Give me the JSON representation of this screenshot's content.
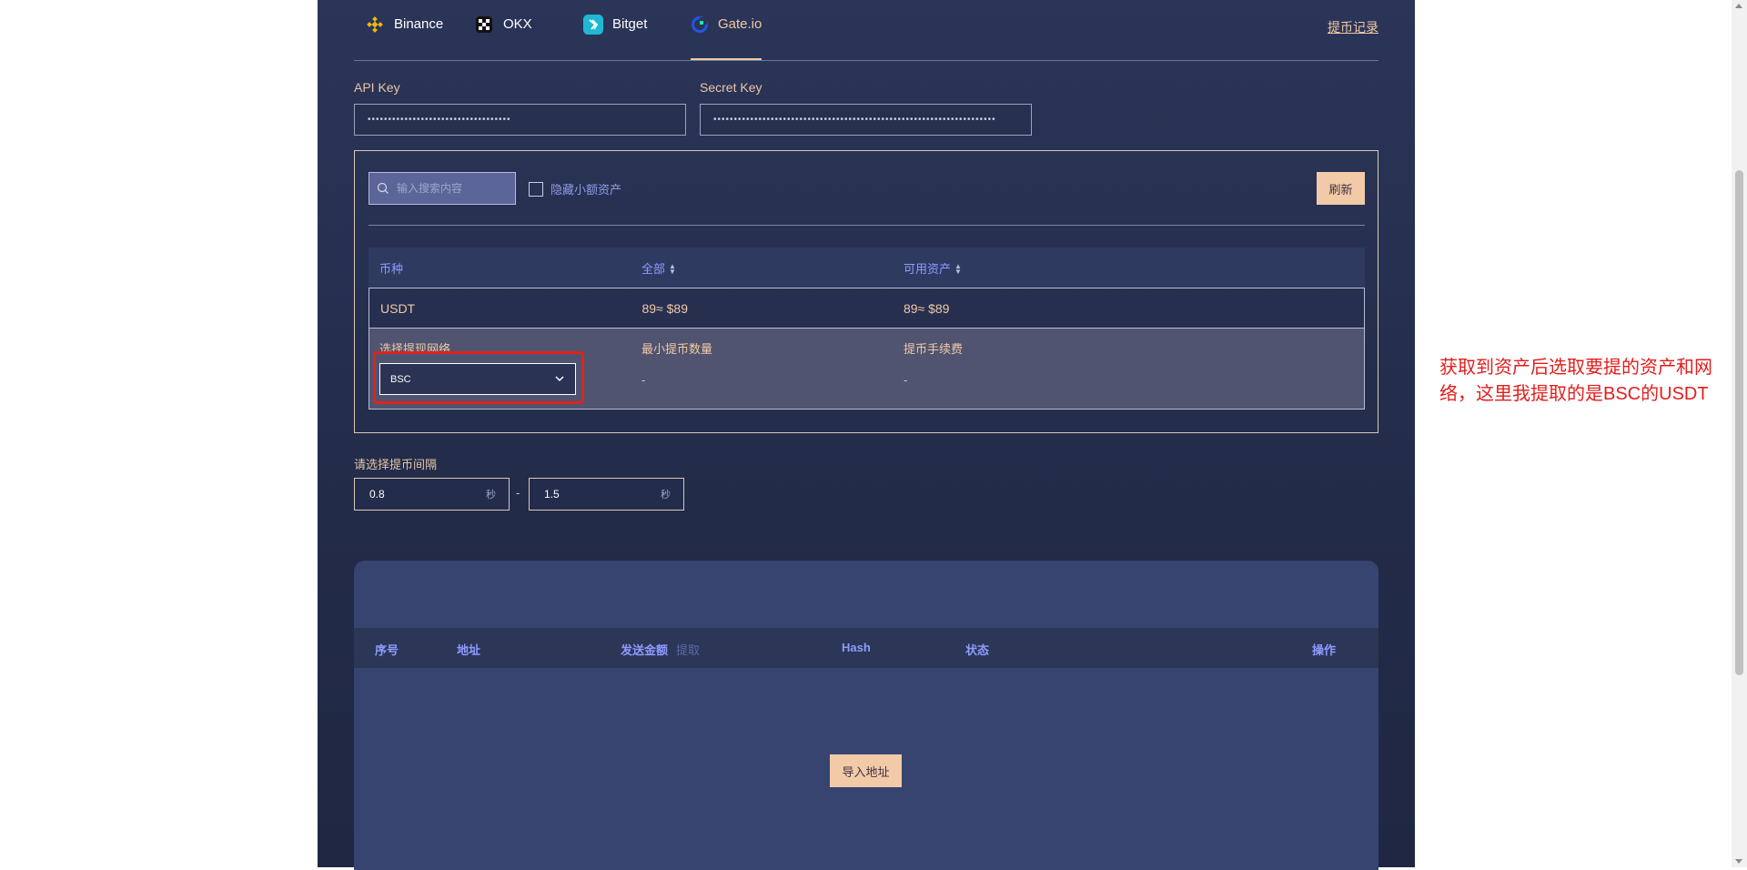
{
  "tabs": [
    {
      "label": "Binance",
      "icon": "binance-icon"
    },
    {
      "label": "OKX",
      "icon": "okx-icon"
    },
    {
      "label": "Bitget",
      "icon": "bitget-icon"
    },
    {
      "label": "Gate.io",
      "icon": "gateio-icon",
      "active": true
    }
  ],
  "record_link": "提币记录",
  "api_key": {
    "label": "API Key",
    "value": "•••••••••••••••••••••••••••••••••••"
  },
  "secret_key": {
    "label": "Secret Key",
    "value": "•••••••••••••••••••••••••••••••••••••••••••••••••••••••••••••••••••••"
  },
  "assets": {
    "search_placeholder": "输入搜索内容",
    "hide_small_label": "隐藏小额资产",
    "refresh_label": "刷新",
    "columns": [
      "币种",
      "全部",
      "可用资产"
    ],
    "row": {
      "coin": "USDT",
      "total": "89≈ $89",
      "available": "89≈ $89"
    },
    "network": {
      "select_label": "选择提现网络",
      "selected": "BSC",
      "min_label": "最小提币数量",
      "min_value": "-",
      "fee_label": "提币手续费",
      "fee_value": "-"
    }
  },
  "interval": {
    "label": "请选择提币间隔",
    "min": "0.8",
    "max": "1.5",
    "unit": "秒",
    "separator": "-"
  },
  "list": {
    "columns": {
      "index": "序号",
      "address": "地址",
      "amount": "发送金额",
      "amount_sub": "提取",
      "hash": "Hash",
      "status": "状态",
      "action": "操作"
    },
    "import_label": "导入地址"
  },
  "annotation": "获取到资产后选取要提的资产和网络，这里我提取的是BSC的USDT",
  "colors": {
    "accent": "#f3caa8",
    "link": "#8e9bff",
    "highlight": "#e0231a"
  }
}
